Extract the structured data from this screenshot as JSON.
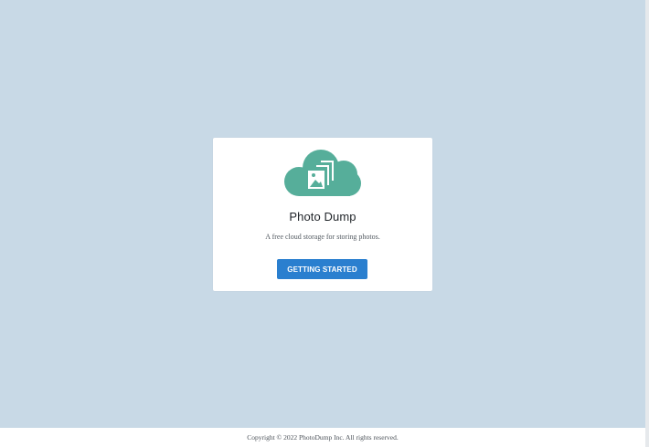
{
  "app": {
    "name": "Photo Dump",
    "tagline": "A free cloud storage for storing photos.",
    "logo_icon": "cloud-photos-icon"
  },
  "actions": {
    "primary_label": "GETTING STARTED"
  },
  "footer": {
    "copyright": "Copyright © 2022 PhotoDump Inc. All rights reserved."
  },
  "colors": {
    "background": "#c8d9e6",
    "card": "#ffffff",
    "logo": "#56ae9a",
    "button": "#2a7fcf",
    "button_text": "#ffffff"
  }
}
